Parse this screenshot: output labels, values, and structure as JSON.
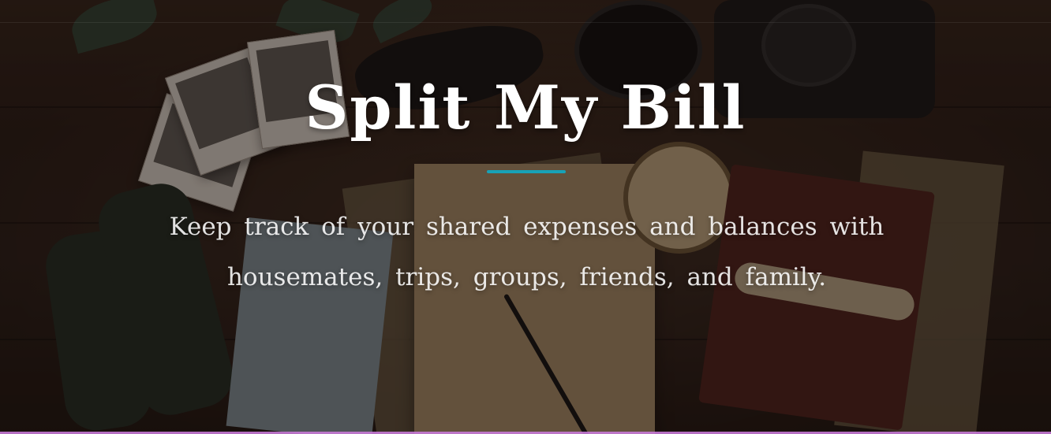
{
  "hero": {
    "title": "Split My Bill",
    "subtitle": "Keep track of your shared expenses and balances with housemates, trips, groups, friends, and family."
  },
  "colors": {
    "accent_underline": "#17a2b8",
    "bottom_border": "#c77ad6",
    "title_text": "#ffffff"
  }
}
